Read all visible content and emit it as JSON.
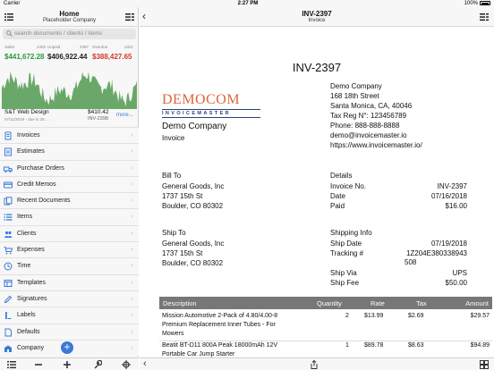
{
  "status": {
    "carrier": "Carrier",
    "time": "2:27 PM",
    "battery": "100%"
  },
  "sidebar": {
    "title": "Home",
    "subtitle": "Placeholder Company",
    "search_placeholder": "search documents / clients / items",
    "stats": [
      {
        "label": "Sales",
        "count": "2403",
        "value": "$441,672.28",
        "color": "#2e9a3c"
      },
      {
        "label": "Unpaid",
        "count": "2397",
        "value": "$406,922.44",
        "color": "#222222"
      },
      {
        "label": "Overdue",
        "count": "2321",
        "value": "$388,427.65",
        "color": "#d23a2a"
      }
    ],
    "chart_color": "#6aa86a",
    "recent": {
      "name": "S&T Web Design",
      "amount": "$410.42",
      "sub": "07/11/2018 - due in 25 ...",
      "number": "INV-2398",
      "more": "more..."
    },
    "items": [
      {
        "label": "Invoices",
        "icon": "invoice-icon"
      },
      {
        "label": "Estimates",
        "icon": "estimate-icon"
      },
      {
        "label": "Purchase Orders",
        "icon": "truck-icon"
      },
      {
        "label": "Credit Memos",
        "icon": "credit-card-icon"
      },
      {
        "label": "Recent Documents",
        "icon": "documents-icon"
      },
      {
        "label": "Items",
        "icon": "list-icon"
      },
      {
        "label": "Clients",
        "icon": "people-icon"
      },
      {
        "label": "Expenses",
        "icon": "cart-icon"
      },
      {
        "label": "Time",
        "icon": "clock-icon"
      },
      {
        "label": "Templates",
        "icon": "template-icon"
      },
      {
        "label": "Signatures",
        "icon": "pen-icon"
      },
      {
        "label": "Labels",
        "icon": "label-icon"
      },
      {
        "label": "Defaults",
        "icon": "doc-icon"
      },
      {
        "label": "Company",
        "icon": "building-icon"
      }
    ]
  },
  "main": {
    "title": "INV-2397",
    "subtitle": "Invoice"
  },
  "invoice": {
    "number": "INV-2397",
    "logo_top": "DEMOCOM",
    "logo_bottom": "INVOICEMASTER",
    "company_name": "Demo Company",
    "doc_type": "Invoice",
    "company_addr": [
      "Demo Company",
      "168 18th Street",
      "Santa Monica, CA, 40046",
      "Tax Reg N°: 123456789",
      "Phone: 888-888-8888",
      "demo@invoicemaster.io",
      "https://www.invoicemaster.io/"
    ],
    "bill_to_label": "Bill To",
    "bill_to": [
      "General Goods, Inc",
      "1737 15th St",
      "Boulder, CO 80302"
    ],
    "details_label": "Details",
    "details": [
      {
        "k": "Invoice No.",
        "v": "INV-2397"
      },
      {
        "k": "Date",
        "v": "07/16/2018"
      },
      {
        "k": "Paid",
        "v": "$16.00"
      }
    ],
    "ship_to_label": "Ship To",
    "ship_to": [
      "General Goods, Inc",
      "1737 15th St",
      "Boulder, CO 80302"
    ],
    "shipping_label": "Shipping Info",
    "ship_date_k": "Ship Date",
    "ship_date_v": "07/19/2018",
    "tracking_k": "Tracking #",
    "tracking_v1": "1Z204E380338943",
    "tracking_v2": "508",
    "ship_via_k": "Ship Via",
    "ship_via_v": "UPS",
    "ship_fee_k": "Ship Fee",
    "ship_fee_v": "$50.00",
    "columns": [
      "Description",
      "Quantity",
      "Rate",
      "Tax",
      "Amount"
    ],
    "rows": [
      {
        "desc1": "Mission Automotive 2-Pack of 4.80/4.00-8",
        "desc2": "Premium Replacement Inner Tubes - For",
        "desc3": "Mowers",
        "qty": "2",
        "rate": "$13.99",
        "tax": "$2.69",
        "amount": "$29.57"
      },
      {
        "desc1": "Beatit BT-D11 800A Peak 18000mAh 12V",
        "desc2": "Portable Car Jump Starter",
        "desc3": "",
        "qty": "1",
        "rate": "$89.78",
        "tax": "$8.63",
        "amount": "$94.89"
      }
    ]
  }
}
